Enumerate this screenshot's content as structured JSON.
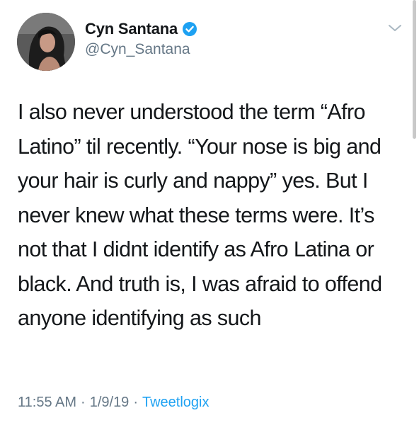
{
  "tweet": {
    "author": {
      "display_name": "Cyn Santana",
      "handle": "@Cyn_Santana",
      "verified": true,
      "avatar_icon": "profile-photo"
    },
    "text": "I also never understood the term “Afro Latino” til recently. “Your nose is big and your hair is curly and nappy” yes. But I never knew what these terms were. It’s not that I didnt identify as Afro Latina or black. And truth is, I was afraid to offend anyone identifying as such",
    "time": "11:55 AM",
    "separator": "·",
    "date": "1/9/19",
    "source": "Tweetlogix"
  },
  "colors": {
    "accent": "#1da1f2",
    "secondary_text": "#657786",
    "primary_text": "#14171a"
  }
}
